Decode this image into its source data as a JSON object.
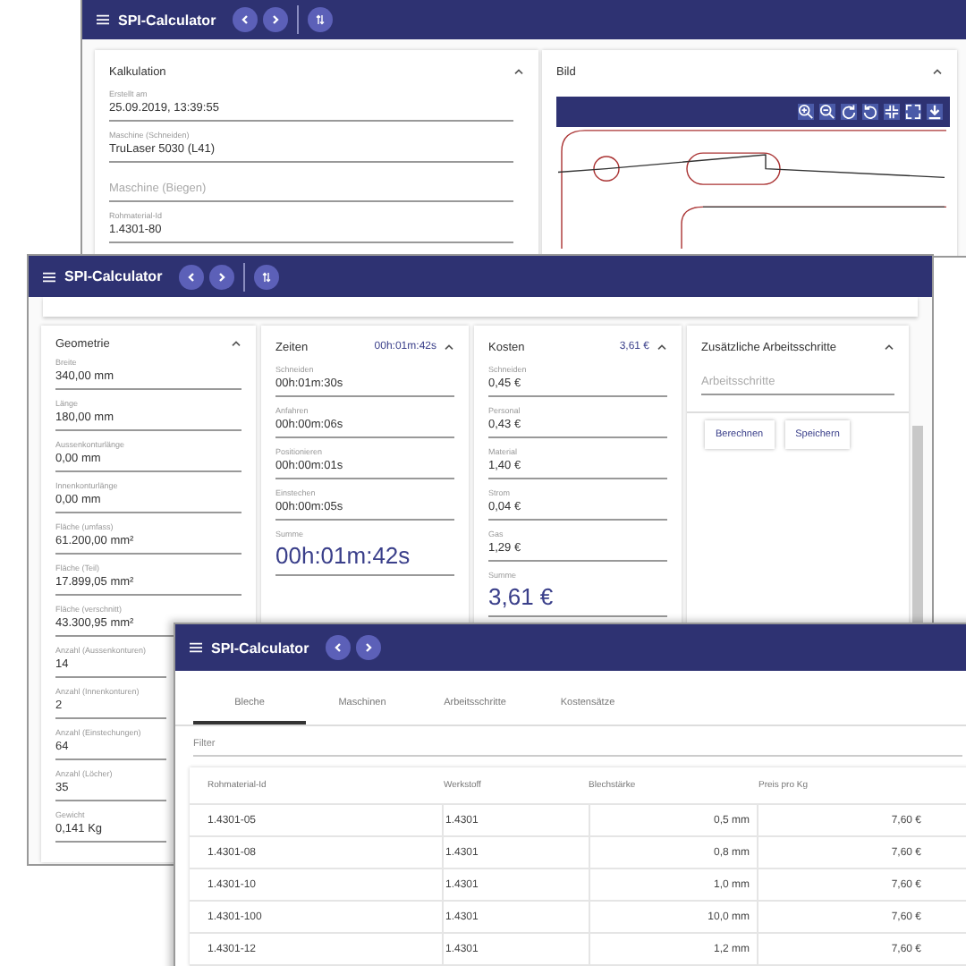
{
  "back_window": {
    "title": "SPI-Calculator",
    "sort_button": true,
    "kalkulation": {
      "title": "Kalkulation",
      "fields": [
        {
          "label": "Erstellt am",
          "value": "25.09.2019, 13:39:55"
        },
        {
          "label": "Maschine (Schneiden)",
          "value": "TruLaser 5030 (L41)"
        },
        {
          "placeholder": "Maschine (Biegen)"
        },
        {
          "label": "Rohmaterial-Id",
          "value": "1.4301-80"
        }
      ]
    },
    "bild": {
      "title": "Bild"
    }
  },
  "middle_window": {
    "title": "SPI-Calculator",
    "sort_button": true,
    "panels": [
      {
        "kind": "fields",
        "title": "Geometrie",
        "fields": [
          {
            "label": "Breite",
            "value": "340,00 mm"
          },
          {
            "label": "Länge",
            "value": "180,00 mm"
          },
          {
            "label": "Aussenkonturlänge",
            "value": "0,00 mm"
          },
          {
            "label": "Innenkonturlänge",
            "value": "0,00 mm"
          },
          {
            "label": "Fläche (umfass)",
            "value": "61.200,00 mm²"
          },
          {
            "label": "Fläche (Teil)",
            "value": "17.899,05 mm²"
          },
          {
            "label": "Fläche (verschnitt)",
            "value": "43.300,95 mm²"
          },
          {
            "label": "Anzahl (Aussenkonturen)",
            "value": "14"
          },
          {
            "label": "Anzahl (Innenkonturen)",
            "value": "2"
          },
          {
            "label": "Anzahl (Einstechungen)",
            "value": "64"
          },
          {
            "label": "Anzahl (Löcher)",
            "value": "35"
          },
          {
            "label": "Gewicht",
            "value": "0,141 Kg"
          }
        ]
      },
      {
        "kind": "fields",
        "title": "Zeiten",
        "total": "00h:01m:42s",
        "fields": [
          {
            "label": "Schneiden",
            "value": "00h:01m:30s"
          },
          {
            "label": "Anfahren",
            "value": "00h:00m:06s"
          },
          {
            "label": "Positionieren",
            "value": "00h:00m:01s"
          },
          {
            "label": "Einstechen",
            "value": "00h:00m:05s"
          }
        ],
        "sum": {
          "label": "Summe",
          "value": "00h:01m:42s"
        }
      },
      {
        "kind": "fields",
        "title": "Kosten",
        "total": "3,61 €",
        "fields": [
          {
            "label": "Schneiden",
            "value": "0,45 €"
          },
          {
            "label": "Personal",
            "value": "0,43 €"
          },
          {
            "label": "Material",
            "value": "1,40 €"
          },
          {
            "label": "Strom",
            "value": "0,04 €"
          },
          {
            "label": "Gas",
            "value": "1,29 €"
          }
        ],
        "sum": {
          "label": "Summe",
          "value": "3,61 €"
        }
      },
      {
        "kind": "steps",
        "title": "Zusätzliche Arbeitsschritte",
        "placeholder": "Arbeitsschritte",
        "buttons": [
          "Berechnen",
          "Speichern"
        ]
      }
    ]
  },
  "front_window": {
    "title": "SPI-Calculator",
    "tabs": [
      {
        "label": "Bleche",
        "selected": true
      },
      {
        "label": "Maschinen",
        "selected": false
      },
      {
        "label": "Arbeitsschritte",
        "selected": false
      },
      {
        "label": "Kostensätze",
        "selected": false
      }
    ],
    "filter": {
      "placeholder": "Filter"
    },
    "table": {
      "columns": [
        "Rohmaterial-Id",
        "Werkstoff",
        "Blechstärke",
        "Preis pro Kg"
      ],
      "rows": [
        [
          "1.4301-05",
          "1.4301",
          "0,5 mm",
          "7,60 €"
        ],
        [
          "1.4301-08",
          "1.4301",
          "0,8 mm",
          "7,60 €"
        ],
        [
          "1.4301-10",
          "1.4301",
          "1,0 mm",
          "7,60 €"
        ],
        [
          "1.4301-100",
          "1.4301",
          "10,0 mm",
          "7,60 €"
        ],
        [
          "1.4301-12",
          "1.4301",
          "1,2 mm",
          "7,60 €"
        ]
      ]
    }
  }
}
